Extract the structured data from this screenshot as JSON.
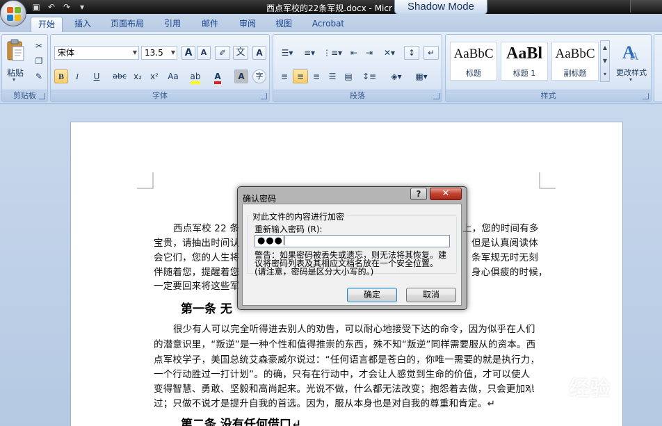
{
  "window": {
    "title": "西点军校的22条军规.docx - Micr",
    "shadow_mode": "Shadow Mode"
  },
  "tabs": [
    {
      "label": "开始",
      "active": true
    },
    {
      "label": "插入"
    },
    {
      "label": "页面布局"
    },
    {
      "label": "引用"
    },
    {
      "label": "邮件"
    },
    {
      "label": "审阅"
    },
    {
      "label": "视图"
    },
    {
      "label": "Acrobat"
    }
  ],
  "ribbon": {
    "clipboard": {
      "paste_label": "粘贴",
      "group_label": "剪贴板"
    },
    "font": {
      "font_name": "宋体",
      "font_size": "13.5",
      "grow": "A",
      "shrink": "A",
      "wen": "文",
      "bold": "B",
      "italic": "I",
      "underline": "U",
      "strike": "abc",
      "subscript": "x₂",
      "superscript": "x²",
      "change_case": "Aa",
      "font_color": "A",
      "char_shading": "A",
      "enclose": "字",
      "group_label": "字体"
    },
    "paragraph": {
      "group_label": "段落"
    },
    "styles": {
      "items": [
        {
          "sample": "AaBbC",
          "name": "标题"
        },
        {
          "sample": "AaBl",
          "name": "标题 1"
        },
        {
          "sample": "AaBbC",
          "name": "副标题"
        }
      ],
      "change_styles": "更改样式",
      "group_label": "样式"
    }
  },
  "document": {
    "para1": [
      "西点军校 22 条",
      "宝贵，请抽出时间认",
      "会它们，您的人生将",
      "伴随着您，提醒着您",
      "一定要回来将这些军"
    ],
    "para1_right": [
      "上，您的时间有多",
      "但是认真阅读体",
      "条军规无时无刻",
      "身心俱疲的时候，"
    ],
    "heading1": "第一条 无",
    "para2": [
      "很少有人可以完全听得进去别人的劝告，可以耐心地接受下达的命令，因为似乎在人们",
      "的潜意识里，“叛逆”是一种个性和值得推崇的东西，殊不知“叛逆”同样需要服从的资本。西",
      "点军校学子，美国总统艾森豪威尔说过：“任何语言都是苍白的，你唯一需要的就是执行力，",
      "一个行动胜过一打计划”。的确，只有在行动中，才会让人感觉到生命的价值，才可以使人",
      "变得智慧、勇敢、坚毅和高尚起来。光说不做，什么都无法改变；抱怨着去做，只会更加难",
      "过；只做不说才是提升自我的首选。因为，服从本身也是对自我的尊重和肯定。↵"
    ],
    "heading2": "第二条 没有任何借口↵"
  },
  "dialog": {
    "title": "确认密码",
    "help": "?",
    "close": "✕",
    "group_title": "对此文件的内容进行加密",
    "reenter_label": "重新输入密码 (R):",
    "password_value": "●●●",
    "warning": [
      "警告：如果密码被丢失或遗忘，则无法将其恢复。建",
      "议将密码列表及其相应文档名放在一个安全位置。",
      "(请注意，密码是区分大小写的。)"
    ],
    "ok": "确定",
    "cancel": "取消"
  },
  "watermark": {
    "name": "经验",
    "url": "jingyan.baidu.com"
  },
  "colors": {
    "ribbon_bg": "#d3e1f3",
    "title_bar": "#0e0e0e",
    "close_red": "#c0402d"
  }
}
